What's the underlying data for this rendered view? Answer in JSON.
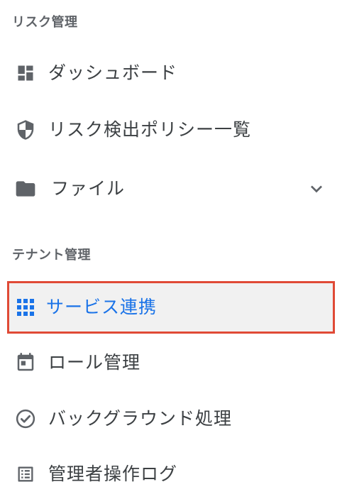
{
  "sections": {
    "risk": {
      "title": "リスク管理"
    },
    "tenant": {
      "title": "テナント管理"
    }
  },
  "nav": {
    "dashboard": {
      "label": "ダッシュボード",
      "icon": "dashboard-icon"
    },
    "policy_list": {
      "label": "リスク検出ポリシー一覧",
      "icon": "shield-icon"
    },
    "files": {
      "label": "ファイル",
      "icon": "folder-icon",
      "expand_icon": "chevron-down-icon"
    },
    "service_integration": {
      "label": "サービス連携",
      "icon": "apps-grid-icon",
      "selected": true
    },
    "role_management": {
      "label": "ロール管理",
      "icon": "calendar-icon"
    },
    "background_jobs": {
      "label": "バックグラウンド処理",
      "icon": "check-circle-icon"
    },
    "admin_logs": {
      "label": "管理者操作ログ",
      "icon": "list-alt-icon"
    }
  },
  "colors": {
    "icon_default": "#5f6368",
    "text_default": "#3c4043",
    "accent": "#1a73e8",
    "selected_border": "#e04a36",
    "selected_bg": "#f1f1f1"
  }
}
